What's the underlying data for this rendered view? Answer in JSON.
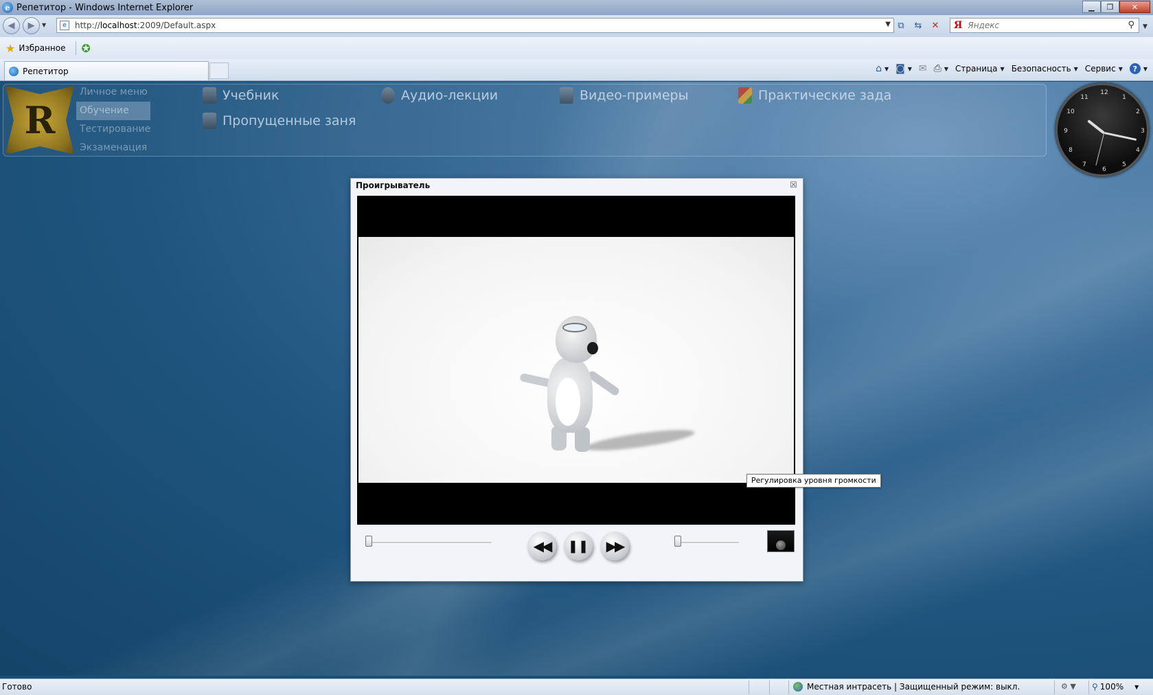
{
  "window": {
    "title": "Репетитор - Windows Internet Explorer"
  },
  "address_bar": {
    "url_prefix": "http://",
    "url_host": "localhost",
    "url_rest": ":2009/Default.aspx"
  },
  "search": {
    "provider_glyph": "Я",
    "placeholder": "Яндекс"
  },
  "favorites": {
    "label": "Избранное"
  },
  "tabs": [
    {
      "label": "Репетитор"
    }
  ],
  "command_bar": {
    "page_label": "Страница",
    "safety_label": "Безопасность",
    "tools_label": "Сервис",
    "help_glyph": "?"
  },
  "app": {
    "logo_letter": "R",
    "side_menu": [
      {
        "label": "Личное меню"
      },
      {
        "label": "Обучение"
      },
      {
        "label": "Тестирование"
      },
      {
        "label": "Экзаменация"
      }
    ],
    "top_menu": [
      {
        "label": "Учебник"
      },
      {
        "label": "Аудио-лекции"
      },
      {
        "label": "Видео-примеры"
      },
      {
        "label": "Практические зада"
      },
      {
        "label": "Пропущенные заня"
      }
    ]
  },
  "clock": {
    "numbers": [
      "12",
      "1",
      "2",
      "3",
      "4",
      "5",
      "6",
      "7",
      "8",
      "9",
      "10",
      "11"
    ]
  },
  "player": {
    "title": "Проигрыватель",
    "close_glyph": "☒",
    "rewind_glyph": "◀◀",
    "pause_glyph": "❚❚",
    "forward_glyph": "▶▶",
    "seek_position": 0.0,
    "volume_level": 0.0
  },
  "tooltip": {
    "text": "Регулировка уровня громкости"
  },
  "status_bar": {
    "text": "Готово",
    "zone": "Местная интрасеть | Защищенный режим: выкл.",
    "zoom": "100%"
  }
}
